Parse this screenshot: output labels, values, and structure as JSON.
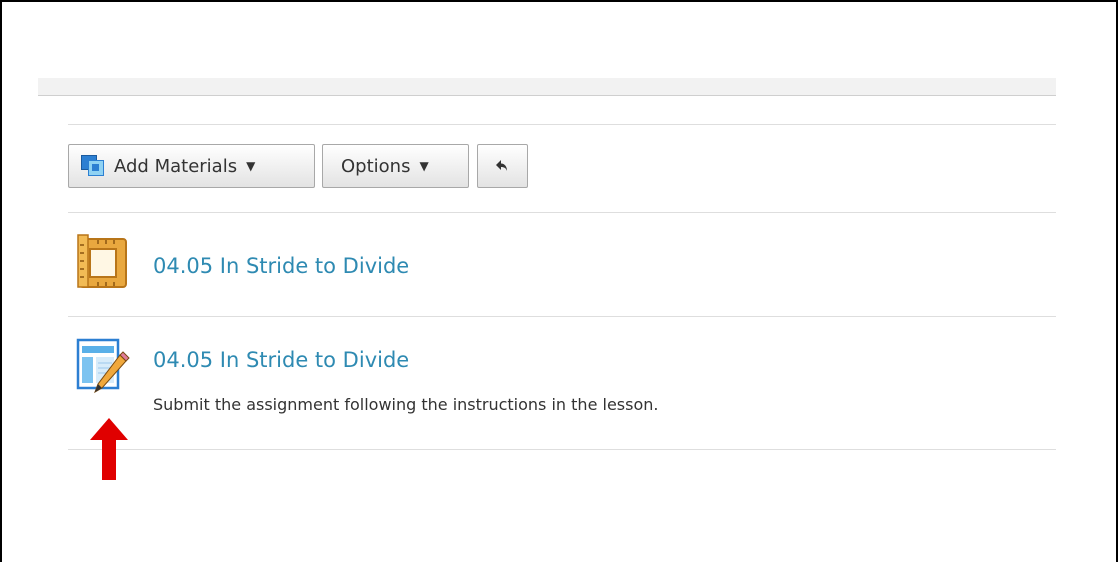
{
  "toolbar": {
    "add_materials_label": "Add Materials",
    "options_label": "Options",
    "undo_icon": "undo-arrow-icon"
  },
  "items": [
    {
      "icon": "ruler-frame-icon",
      "title": "04.05 In Stride to Divide"
    },
    {
      "icon": "assignment-pencil-icon",
      "title": "04.05 In Stride to Divide",
      "description": "Submit the assignment following the instructions in the lesson."
    }
  ],
  "annotation": {
    "arrow_color": "#e00000",
    "arrow_icon": "red-up-arrow-icon"
  },
  "colors": {
    "link": "#2e8ab2",
    "text": "#333333",
    "toolbar_icon_blue": "#2c7fd2",
    "ruler_orange": "#e6a33a"
  }
}
